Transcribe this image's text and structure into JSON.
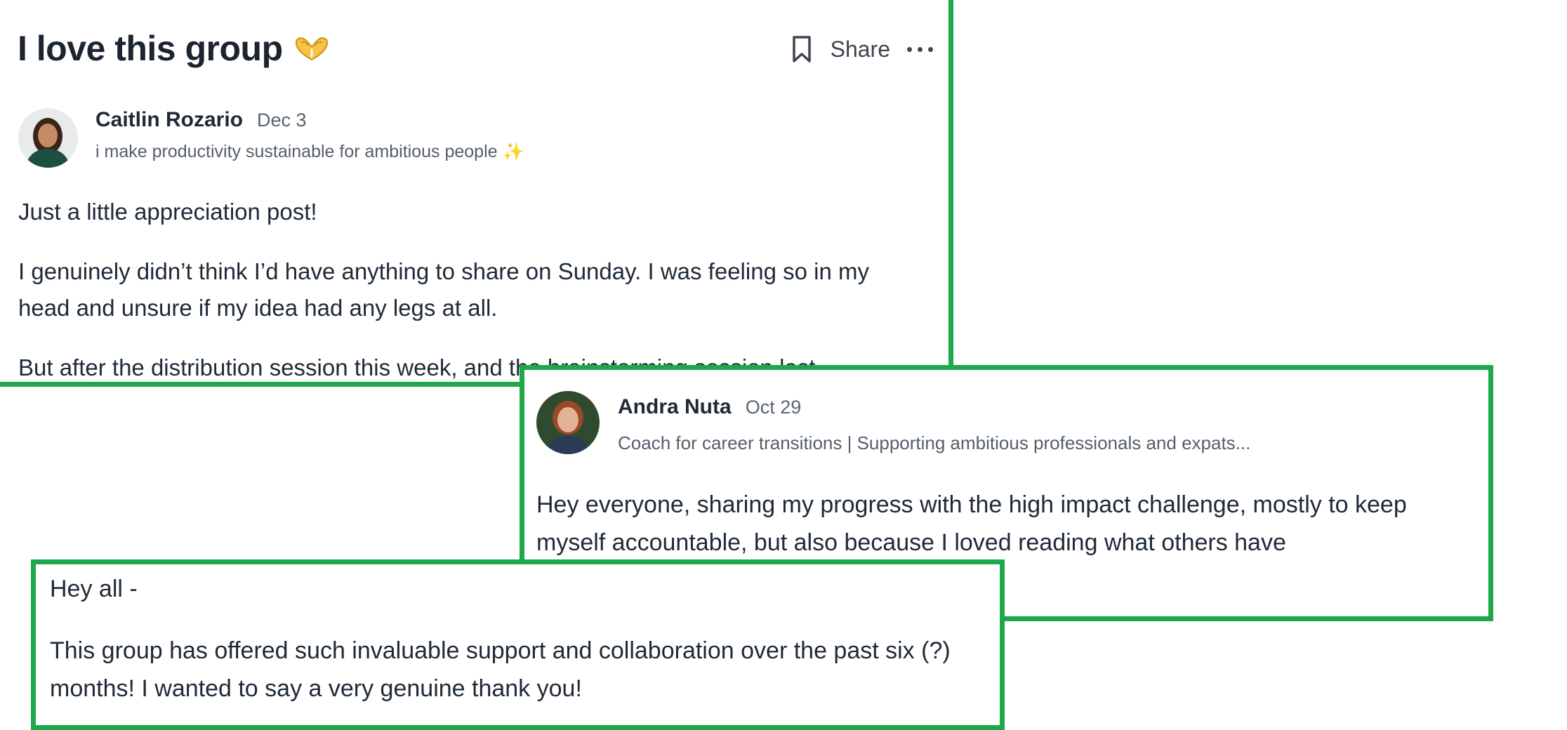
{
  "post1": {
    "title": "I love this group",
    "title_emoji": "heart-hands-emoji",
    "actions": {
      "bookmark_icon": "bookmark-icon",
      "share_label": "Share",
      "more_icon": "more-horizontal-icon"
    },
    "author": {
      "name": "Caitlin Rozario",
      "date": "Dec 3",
      "tagline": "i make productivity sustainable for ambitious people ✨"
    },
    "paragraphs": [
      "Just a little appreciation post!",
      "I genuinely didn’t think I’d have anything to share on Sunday. I was feeling so in my head and unsure if my idea had any legs at all.",
      "But after the distribution session this week, and the brainstorming session last"
    ]
  },
  "post2": {
    "author": {
      "name": "Andra Nuta",
      "date": "Oct 29",
      "tagline": "Coach for career transitions | Supporting ambitious professionals and expats..."
    },
    "paragraphs": [
      "Hey everyone, sharing my progress with the high impact challenge, mostly to keep myself accountable, but also because I loved reading what others have"
    ]
  },
  "post3": {
    "paragraphs": [
      "Hey all -",
      "This group has offered such invaluable support and collaboration over the past six (?) months! I wanted to say a very genuine thank you!"
    ]
  },
  "colors": {
    "highlight_border": "#1fa84a",
    "text": "#1f2a37",
    "muted": "#5b6470"
  }
}
